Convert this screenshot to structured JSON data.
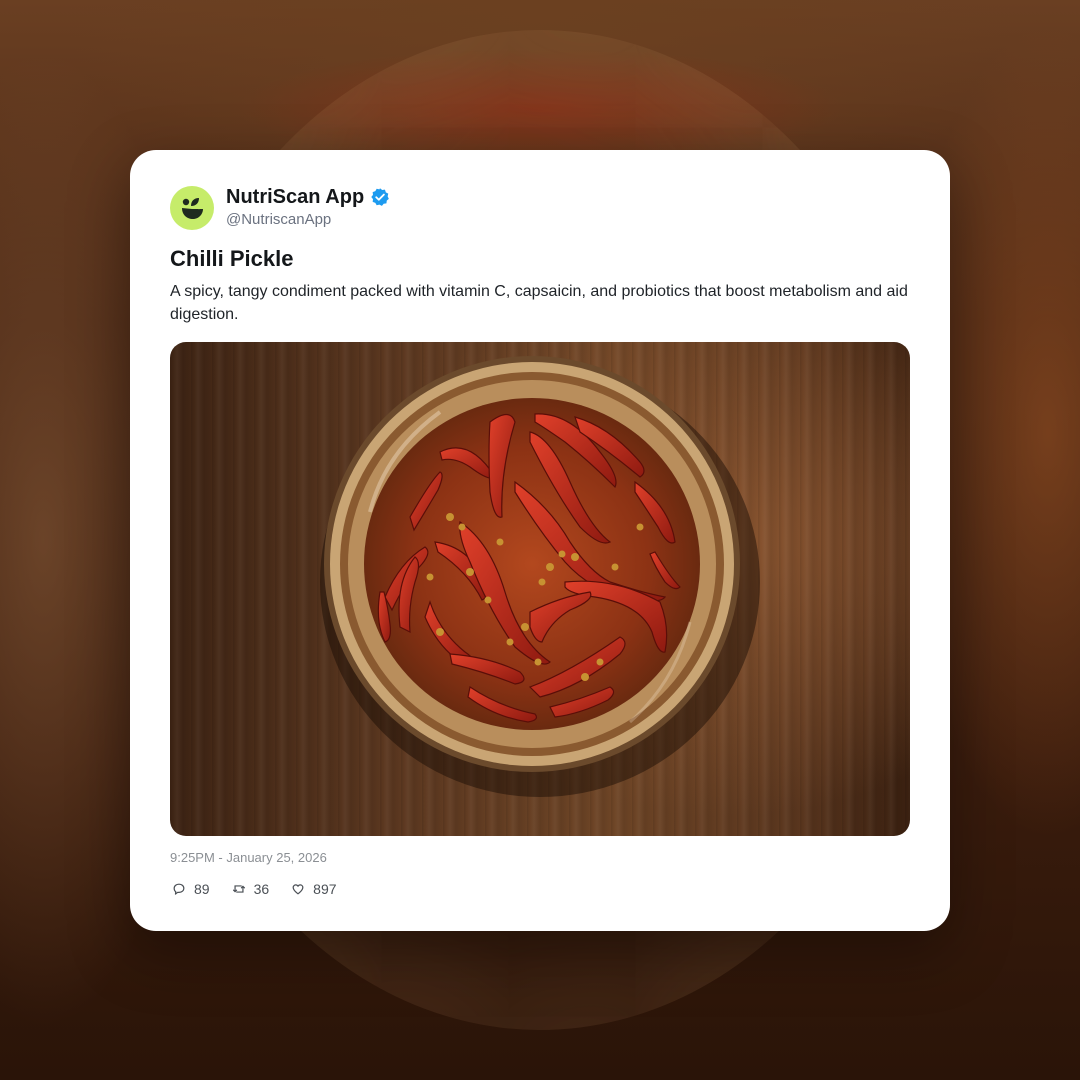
{
  "post": {
    "author_name": "NutriScan App",
    "author_handle": "@NutriscanApp",
    "verified": true,
    "title": "Chilli Pickle",
    "description": "A spicy, tangy condiment packed with vitamin C, capsaicin, and probiotics that boost metabolism and aid digestion.",
    "timestamp": "9:25PM - January 25, 2026",
    "stats": {
      "replies": "89",
      "reposts": "36",
      "likes": "897"
    }
  },
  "icons": {
    "avatar": "nutriscan-logo-icon",
    "verified": "verified-badge-icon",
    "replies": "comment-icon",
    "reposts": "repost-icon",
    "likes": "heart-icon"
  },
  "colors": {
    "avatar_bg": "#c6ec6a",
    "verified_blue": "#1d9bf0",
    "card_bg": "#ffffff"
  }
}
